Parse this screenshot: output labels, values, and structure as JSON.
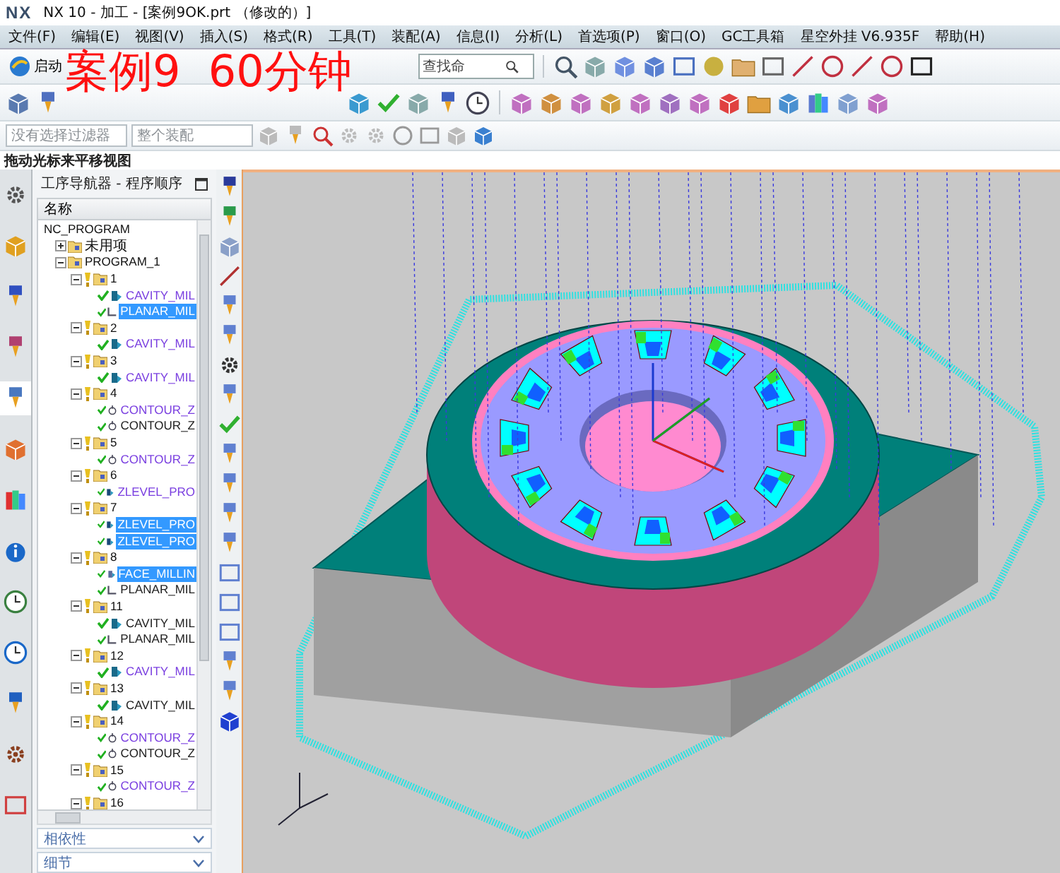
{
  "window": {
    "logo": "NX",
    "title": "NX 10 - 加工 - [案例9OK.prt （修改的）]"
  },
  "menu": [
    "文件(F)",
    "编辑(E)",
    "视图(V)",
    "插入(S)",
    "格式(R)",
    "工具(T)",
    "装配(A)",
    "信息(I)",
    "分析(L)",
    "首选项(P)",
    "窗口(O)",
    "GC工具箱",
    "星空外挂 V6.935F",
    "帮助(H)"
  ],
  "toolbar": {
    "start_button": "启动",
    "command_search": {
      "placeholder": "查找命"
    },
    "selection_filter": "没有选择过滤器",
    "assembly_scope": "整个装配"
  },
  "overlay_caption": "案例9  60分钟",
  "hint": "拖动光标来平移视图",
  "navigator": {
    "title": "工序导航器 - 程序顺序",
    "column": "名称",
    "tree": [
      {
        "label": "NC_PROGRAM",
        "kind": "root",
        "children": [
          {
            "label": "未用项",
            "kind": "group",
            "expanded": false
          },
          {
            "label": "PROGRAM_1",
            "kind": "group",
            "expanded": true,
            "children": [
              {
                "label": "1",
                "kind": "group",
                "expanded": true,
                "children": [
                  {
                    "label": "CAVITY_MIL",
                    "kind": "cavity",
                    "color": "#7a3fe0",
                    "selected": false
                  },
                  {
                    "label": "PLANAR_MIL",
                    "kind": "planar",
                    "selected": true
                  }
                ]
              },
              {
                "label": "2",
                "kind": "group",
                "expanded": true,
                "children": [
                  {
                    "label": "CAVITY_MIL",
                    "kind": "cavity",
                    "color": "#7a3fe0",
                    "selected": false
                  }
                ]
              },
              {
                "label": "3",
                "kind": "group",
                "expanded": true,
                "children": [
                  {
                    "label": "CAVITY_MIL",
                    "kind": "cavity",
                    "color": "#7a3fe0",
                    "selected": false
                  }
                ]
              },
              {
                "label": "4",
                "kind": "group",
                "expanded": true,
                "children": [
                  {
                    "label": "CONTOUR_Z",
                    "kind": "contour",
                    "color": "#7a3fe0",
                    "selected": false
                  },
                  {
                    "label": "CONTOUR_Z",
                    "kind": "contour",
                    "color": "#222222",
                    "selected": false
                  }
                ]
              },
              {
                "label": "5",
                "kind": "group",
                "expanded": true,
                "children": [
                  {
                    "label": "CONTOUR_Z",
                    "kind": "contour",
                    "color": "#7a3fe0",
                    "selected": false
                  }
                ]
              },
              {
                "label": "6",
                "kind": "group",
                "expanded": true,
                "children": [
                  {
                    "label": "ZLEVEL_PRO",
                    "kind": "zlevel",
                    "color": "#7a3fe0",
                    "selected": false
                  }
                ]
              },
              {
                "label": "7",
                "kind": "group",
                "expanded": true,
                "children": [
                  {
                    "label": "ZLEVEL_PRO",
                    "kind": "zlevel",
                    "selected": true
                  },
                  {
                    "label": "ZLEVEL_PRO",
                    "kind": "zlevel",
                    "selected": true
                  }
                ]
              },
              {
                "label": "8",
                "kind": "group",
                "expanded": true,
                "children": [
                  {
                    "label": "FACE_MILLIN",
                    "kind": "face",
                    "selected": true
                  },
                  {
                    "label": "PLANAR_MIL",
                    "kind": "planar",
                    "color": "#222222",
                    "selected": false
                  }
                ]
              },
              {
                "label": "11",
                "kind": "group",
                "expanded": true,
                "children": [
                  {
                    "label": "CAVITY_MIL",
                    "kind": "cavity",
                    "color": "#222222",
                    "selected": false
                  },
                  {
                    "label": "PLANAR_MIL",
                    "kind": "planar",
                    "color": "#222222",
                    "selected": false
                  }
                ]
              },
              {
                "label": "12",
                "kind": "group",
                "expanded": true,
                "children": [
                  {
                    "label": "CAVITY_MIL",
                    "kind": "cavity",
                    "color": "#7a3fe0",
                    "selected": false
                  }
                ]
              },
              {
                "label": "13",
                "kind": "group",
                "expanded": true,
                "children": [
                  {
                    "label": "CAVITY_MIL",
                    "kind": "cavity",
                    "color": "#222222",
                    "selected": false
                  }
                ]
              },
              {
                "label": "14",
                "kind": "group",
                "expanded": true,
                "children": [
                  {
                    "label": "CONTOUR_Z",
                    "kind": "contour",
                    "color": "#7a3fe0",
                    "selected": false
                  },
                  {
                    "label": "CONTOUR_Z",
                    "kind": "contour",
                    "color": "#222222",
                    "selected": false
                  }
                ]
              },
              {
                "label": "15",
                "kind": "group",
                "expanded": true,
                "children": [
                  {
                    "label": "CONTOUR_Z",
                    "kind": "contour",
                    "color": "#7a3fe0",
                    "selected": false
                  }
                ]
              },
              {
                "label": "16",
                "kind": "group",
                "expanded": true
              }
            ]
          }
        ]
      }
    ]
  },
  "panels": [
    {
      "label": "相依性",
      "expanded": false
    },
    {
      "label": "细节",
      "expanded": false
    }
  ]
}
